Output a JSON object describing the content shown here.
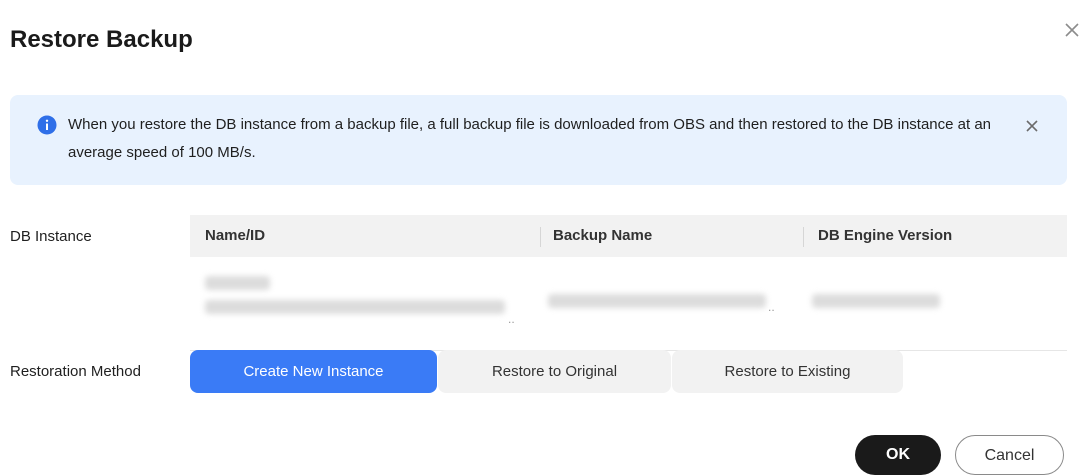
{
  "dialog": {
    "title": "Restore Backup",
    "close_icon": "close-icon"
  },
  "alert": {
    "icon": "info-icon",
    "text": "When you restore the DB instance from a backup file, a full backup file is downloaded from OBS and then restored to the DB instance at an average speed of 100 MB/s.",
    "close_icon": "close-icon"
  },
  "db_instance": {
    "label": "DB Instance",
    "columns": [
      "Name/ID",
      "Backup Name",
      "DB Engine Version"
    ]
  },
  "restoration": {
    "label": "Restoration Method",
    "options": [
      "Create New Instance",
      "Restore to Original",
      "Restore to Existing"
    ],
    "selected": "Create New Instance"
  },
  "footer": {
    "ok_label": "OK",
    "cancel_label": "Cancel"
  },
  "colors": {
    "accent": "#3a7bf6",
    "alert_bg": "#e8f2fe",
    "ok_bg": "#1a1a1a"
  }
}
